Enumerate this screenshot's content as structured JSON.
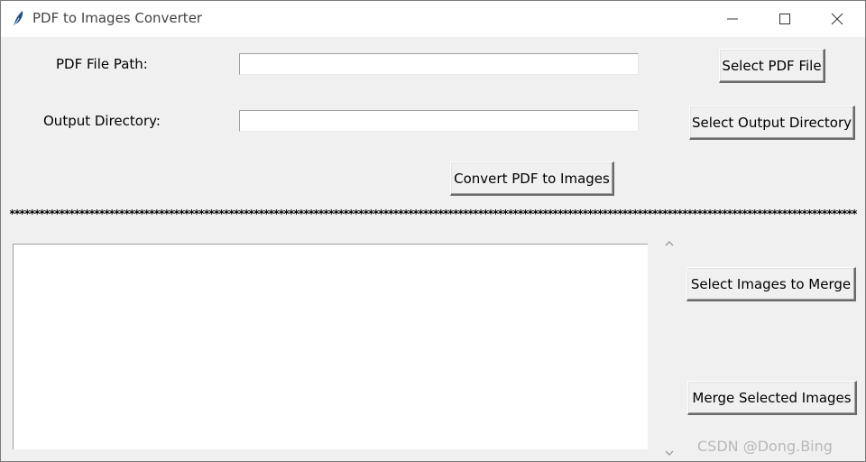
{
  "window": {
    "title": "PDF to Images Converter"
  },
  "form": {
    "pdf_path_label": "PDF File Path:",
    "pdf_path_value": "",
    "output_dir_label": "Output Directory:",
    "output_dir_value": "",
    "select_pdf_button": "Select PDF File",
    "select_output_button": "Select Output Directory",
    "convert_button": "Convert PDF to Images"
  },
  "separator": "****************************************************************************************************************************************************************************************************",
  "merge": {
    "select_images_button": "Select Images to Merge",
    "merge_button": "Merge Selected Images",
    "list_items": []
  },
  "watermark": "CSDN @Dong.Bing",
  "icons": {
    "app": "feather-icon",
    "minimize": "minimize-icon",
    "maximize": "maximize-icon",
    "close": "close-icon",
    "scroll_up": "chevron-up-icon",
    "scroll_down": "chevron-down-icon"
  }
}
